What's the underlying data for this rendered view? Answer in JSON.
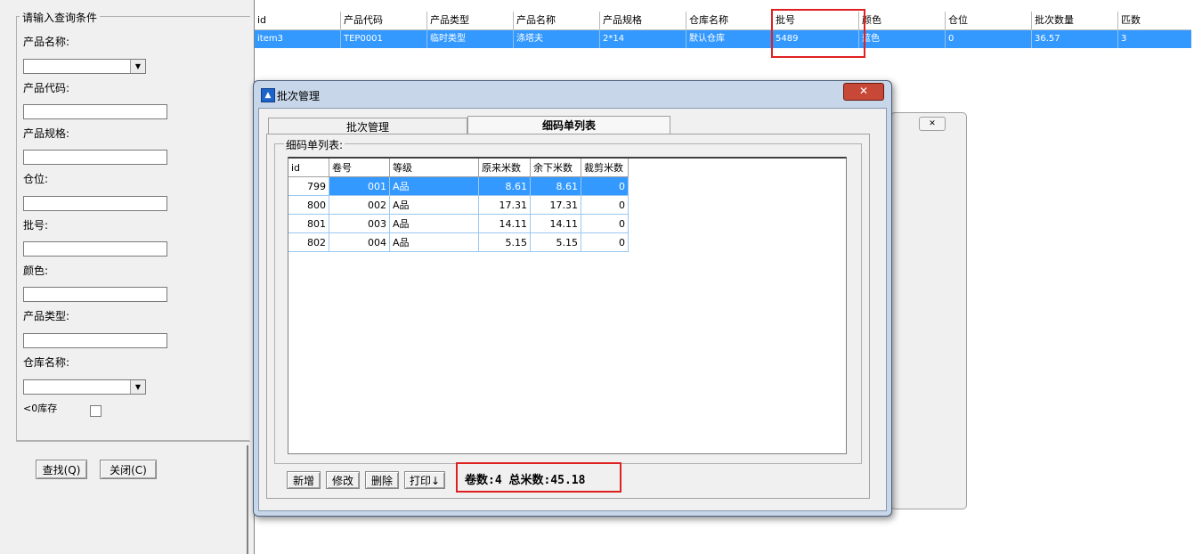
{
  "query_panel": {
    "legend": "请输入查询条件",
    "fields": {
      "product_name": "产品名称:",
      "product_code": "产品代码:",
      "product_spec": "产品规格:",
      "location": "仓位:",
      "batch_no": "批号:",
      "color": "颜色:",
      "product_type": "产品类型:",
      "warehouse_name": "仓库名称:",
      "zero_stock": "<0库存"
    },
    "buttons": {
      "search": "查找(Q)",
      "close": "关闭(C)"
    }
  },
  "main_grid": {
    "columns": [
      "id",
      "产品代码",
      "产品类型",
      "产品名称",
      "产品规格",
      "仓库名称",
      "批号",
      "颜色",
      "仓位",
      "批次数量",
      "匹数"
    ],
    "row": [
      "item3",
      "TEP0001",
      "临时类型",
      "涤塔夫",
      "2*14",
      "默认仓库",
      "5489",
      "蓝色",
      "0",
      "36.57",
      "3"
    ]
  },
  "bg_dialog": {
    "close_glyph": "✕"
  },
  "dialog": {
    "title": "批次管理",
    "close_glyph": "✕",
    "tabs": [
      "批次管理",
      "细码单列表"
    ],
    "group_legend": "细码单列表:",
    "detail_grid": {
      "columns": [
        "id",
        "卷号",
        "等级",
        "原来米数",
        "余下米数",
        "裁剪米数"
      ],
      "rows": [
        [
          "799",
          "001",
          "A品",
          "8.61",
          "8.61",
          "0"
        ],
        [
          "800",
          "002",
          "A品",
          "17.31",
          "17.31",
          "0"
        ],
        [
          "801",
          "003",
          "A品",
          "14.11",
          "14.11",
          "0"
        ],
        [
          "802",
          "004",
          "A品",
          "5.15",
          "5.15",
          "0"
        ]
      ]
    },
    "buttons": {
      "add": "新增",
      "edit": "修改",
      "delete": "删除",
      "print": "打印↓"
    },
    "summary": "卷数:4  总米数:45.18"
  },
  "colors": {
    "selection": "#3399ff",
    "highlight_box": "#e02020"
  }
}
